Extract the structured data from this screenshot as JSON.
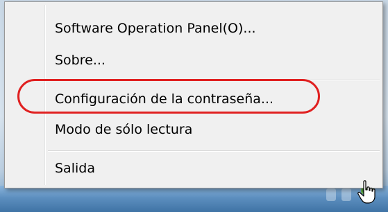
{
  "menu": {
    "items": [
      {
        "label": "Software Operation Panel(O)..."
      },
      {
        "label": "Sobre..."
      },
      {
        "label": "Configuración de la contraseña..."
      },
      {
        "label": "Modo de sólo lectura"
      },
      {
        "label": "Salida"
      }
    ]
  },
  "annotation": {
    "highlight_color": "#e02020"
  },
  "icons": {
    "tray_app": "scanner-app-icon",
    "cursor": "hand-pointer-icon"
  }
}
